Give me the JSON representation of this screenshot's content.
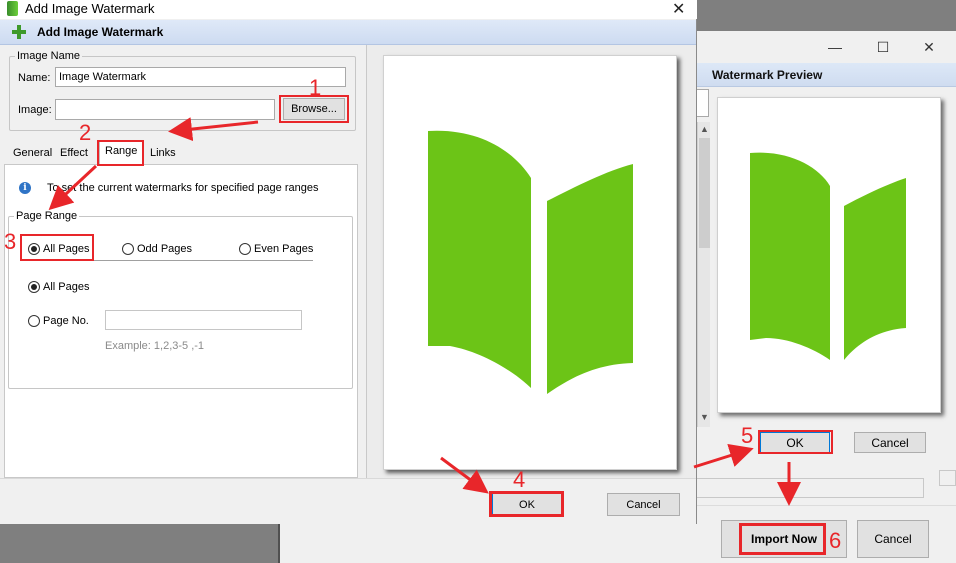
{
  "dialog": {
    "window_title": "Add Image Watermark",
    "header_title": "Add Image Watermark",
    "image_name_group": "Image Name",
    "name_label": "Name:",
    "name_value": "Image Watermark",
    "image_label": "Image:",
    "image_value": "",
    "browse_label": "Browse...",
    "tabs": [
      "General",
      "Effect",
      "Range",
      "Links"
    ],
    "info_text": "To set the current watermarks for specified page ranges",
    "page_range_group": "Page Range",
    "range_options": [
      "All Pages",
      "Odd Pages",
      "Even Pages"
    ],
    "scope_all": "All Pages",
    "scope_pageno": "Page No.",
    "pageno_value": "",
    "example_text": "Example: 1,2,3-5 ,-1",
    "ok_label": "OK",
    "cancel_label": "Cancel"
  },
  "preview_window": {
    "header_title": "Watermark Preview",
    "ok_label": "OK",
    "cancel_label": "Cancel",
    "import_label": "Import Now",
    "bottom_cancel_label": "Cancel"
  },
  "annotations": [
    "1",
    "2",
    "3",
    "4",
    "5",
    "6"
  ],
  "colors": {
    "annotation_red": "#e8262a",
    "logo_green": "#6cc417",
    "header_blue": "#d6e3f5"
  }
}
